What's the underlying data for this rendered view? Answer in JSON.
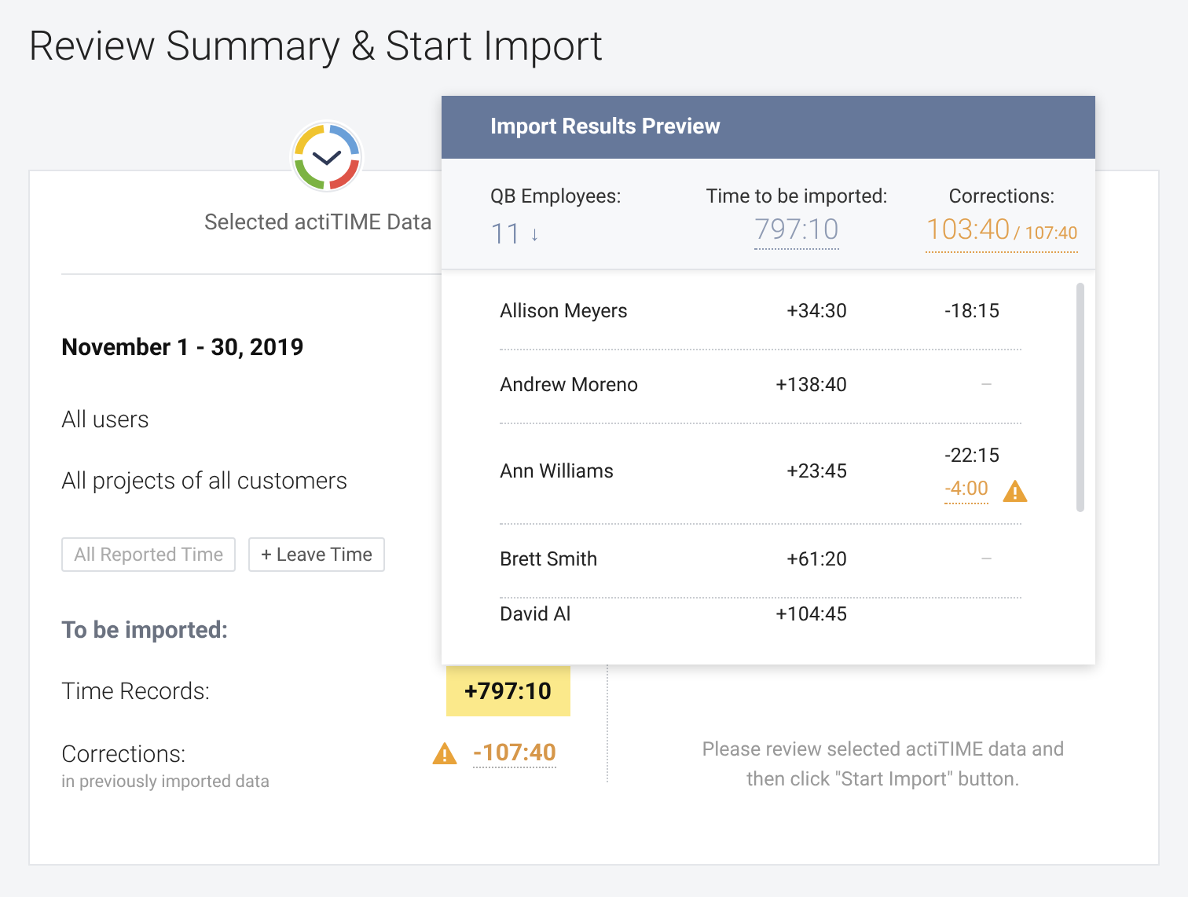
{
  "page_title": "Review Summary & Start Import",
  "selected_data": {
    "heading": "Selected actiTIME Data",
    "period": "November 1 - 30, 2019",
    "users": "All users",
    "projects": "All projects of all customers",
    "filters": [
      {
        "label": "All Reported Time",
        "selected": false
      },
      {
        "label": "+ Leave Time",
        "selected": true
      }
    ],
    "import_heading": "To be imported:",
    "time_records_label": "Time Records:",
    "time_records_value": "+797:10",
    "corrections_label": "Corrections:",
    "corrections_note": "in previously imported data",
    "corrections_value": "-107:40"
  },
  "hint": "Please review selected actiTIME data and then click \"Start Import\" button.",
  "preview": {
    "title": "Import Results Preview",
    "employees_label": "QB Employees:",
    "employees_value": "11",
    "sort_arrow": "↓",
    "time_label": "Time to be imported:",
    "time_value": "797:10",
    "corrections_label": "Corrections:",
    "corrections_value": "103:40",
    "corrections_total": "/ 107:40",
    "rows": [
      {
        "name": "Allison Meyers",
        "time": "+34:30",
        "correction": "-18:15"
      },
      {
        "name": "Andrew Moreno",
        "time": "+138:40",
        "correction": "–"
      },
      {
        "name": "Ann Williams",
        "time": "+23:45",
        "correction": "-22:15",
        "warning_correction": "-4:00"
      },
      {
        "name": "Brett Smith",
        "time": "+61:20",
        "correction": "–"
      },
      {
        "name": "David Al",
        "time": "+104:45"
      }
    ]
  }
}
